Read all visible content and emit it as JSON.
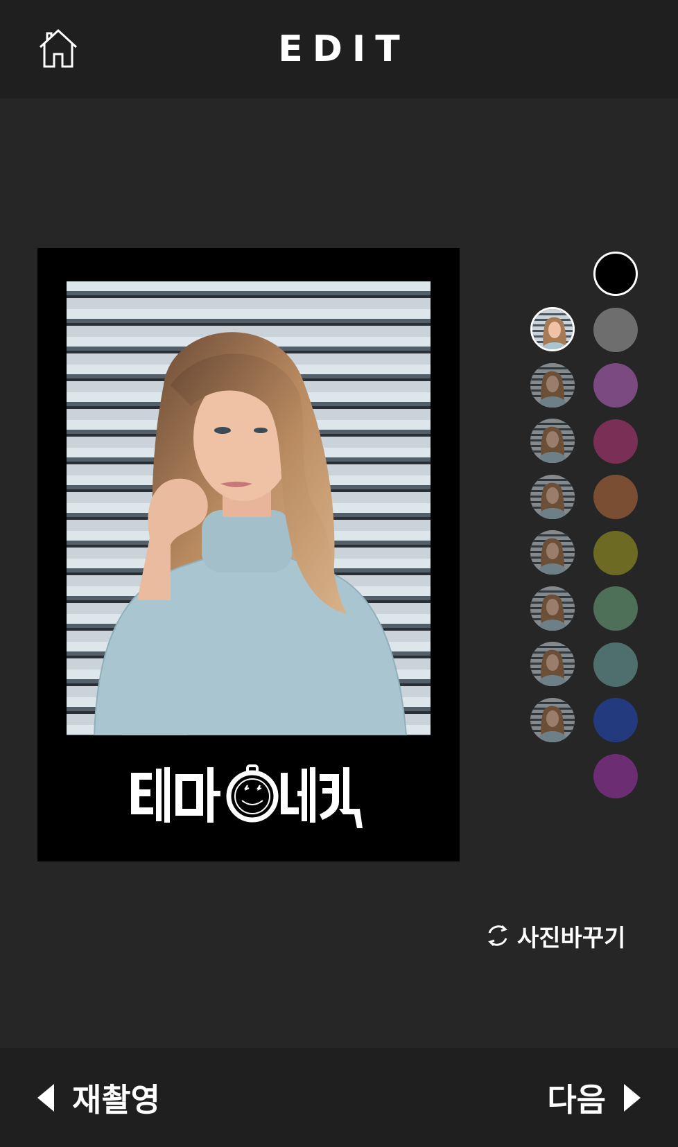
{
  "header": {
    "title": "EDIT"
  },
  "frame": {
    "background": "#000000",
    "logo_text": "테마네컷"
  },
  "palette": {
    "photo_thumbnails": [
      {
        "selected": true
      },
      {
        "selected": false
      },
      {
        "selected": false
      },
      {
        "selected": false
      },
      {
        "selected": false
      },
      {
        "selected": false
      },
      {
        "selected": false
      },
      {
        "selected": false
      }
    ],
    "colors": [
      {
        "hex": "#000000",
        "selected": true
      },
      {
        "hex": "#6e6e6e",
        "selected": false
      },
      {
        "hex": "#7a4a80",
        "selected": false
      },
      {
        "hex": "#7a2f56",
        "selected": false
      },
      {
        "hex": "#7a4e32",
        "selected": false
      },
      {
        "hex": "#6d6a24",
        "selected": false
      },
      {
        "hex": "#4e7058",
        "selected": false
      },
      {
        "hex": "#4f6f6e",
        "selected": false
      },
      {
        "hex": "#233a7e",
        "selected": false
      },
      {
        "hex": "#6d2d72",
        "selected": false
      }
    ]
  },
  "actions": {
    "change_photo": "사진바꾸기"
  },
  "footer": {
    "retake_label": "재촬영",
    "next_label": "다음"
  }
}
